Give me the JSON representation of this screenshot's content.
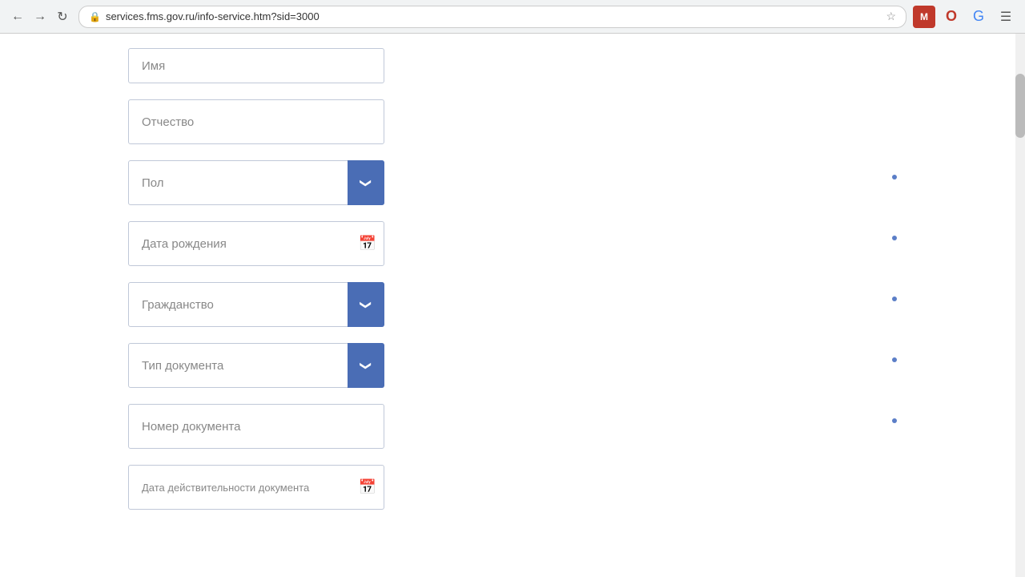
{
  "browser": {
    "url": "services.fms.gov.ru/info-service.htm?sid=3000",
    "back_disabled": false,
    "forward_disabled": false
  },
  "form": {
    "fields": [
      {
        "id": "imya",
        "type": "text",
        "placeholder": "Имя",
        "required": false,
        "value": ""
      },
      {
        "id": "otchestvo",
        "type": "text",
        "placeholder": "Отчество",
        "required": false,
        "value": ""
      },
      {
        "id": "pol",
        "type": "select",
        "placeholder": "Пол",
        "required": true,
        "value": ""
      },
      {
        "id": "data_rozhdeniya",
        "type": "date",
        "placeholder": "Дата рождения",
        "required": true,
        "value": ""
      },
      {
        "id": "grazhdanstvo",
        "type": "select",
        "placeholder": "Гражданство",
        "required": true,
        "value": ""
      },
      {
        "id": "tip_dokumenta",
        "type": "select",
        "placeholder": "Тип документа",
        "required": true,
        "value": ""
      },
      {
        "id": "nomer_dokumenta",
        "type": "text",
        "placeholder": "Номер документа",
        "required": true,
        "value": ""
      },
      {
        "id": "data_deystvitelnosti",
        "type": "date",
        "placeholder": "Дата действительности документа",
        "required": false,
        "value": ""
      }
    ]
  }
}
